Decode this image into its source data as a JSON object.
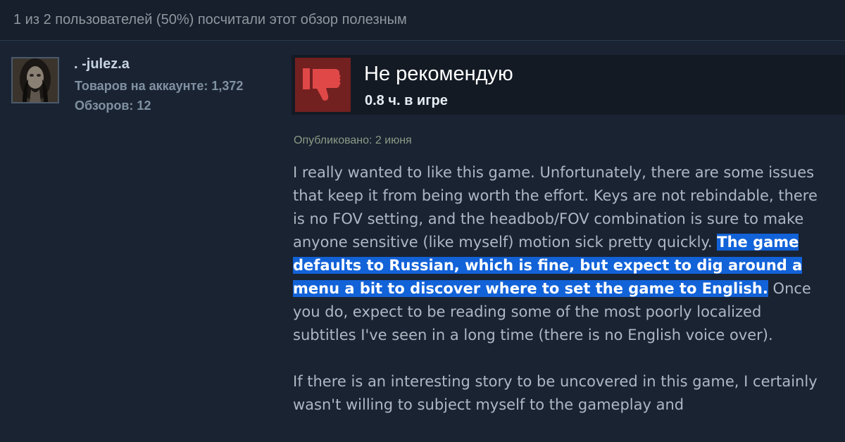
{
  "helpful_text": "1 из 2 пользователей (50%) посчитали этот обзор полезным",
  "author": {
    "name": ". -julez.a",
    "products_label": "Товаров на аккаунте: 1,372",
    "reviews_label": "Обзоров: 12"
  },
  "review": {
    "verdict": "Не рекомендую",
    "hours": "0.8 ч. в игре",
    "posted": "Опубликовано: 2 июня",
    "p1_before": "I really wanted to like this game. Unfortunately, there are some issues that keep it from being worth the effort. Keys are not rebindable, there is no FOV setting, and the headbob/FOV combination is sure to make anyone sensitive (like myself) motion sick pretty quickly. ",
    "p1_highlight": "The game defaults to Russian, which is fine, but expect to dig around a menu a bit to discover where to set the game to English.",
    "p1_after": " Once you do, expect to be reading some of the most poorly localized subtitles I've seen in a long time (there is no English voice over).",
    "p2": "If there is an interesting story to be uncovered in this game, I certainly wasn't willing to subject myself to the gameplay and"
  },
  "colors": {
    "background": "#1b2838",
    "thumb_bg": "#732020",
    "thumb_icon": "#e04848",
    "highlight": "#1262d8"
  },
  "icons": {
    "thumb": "thumbs-down-icon"
  }
}
